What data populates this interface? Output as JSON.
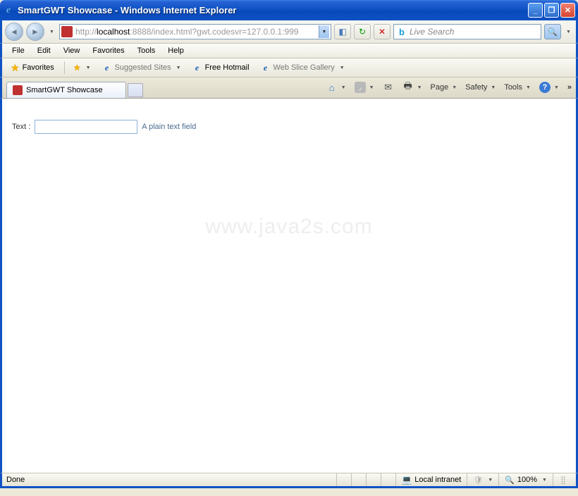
{
  "window": {
    "title": "SmartGWT Showcase - Windows Internet Explorer"
  },
  "nav": {
    "url_prefix": "http://",
    "url_host": "localhost",
    "url_suffix": ":8888/index.html?gwt.codesvr=127.0.0.1:999",
    "search_placeholder": "Live Search"
  },
  "menu": {
    "file": "File",
    "edit": "Edit",
    "view": "View",
    "favorites": "Favorites",
    "tools": "Tools",
    "help": "Help"
  },
  "favbar": {
    "label": "Favorites",
    "suggested": "Suggested Sites",
    "hotmail": "Free Hotmail",
    "webslice": "Web Slice Gallery"
  },
  "tab": {
    "title": "SmartGWT Showcase"
  },
  "cmd": {
    "page": "Page",
    "safety": "Safety",
    "tools": "Tools"
  },
  "form": {
    "label": "Text :",
    "hint": "A plain text field"
  },
  "watermark": "www.java2s.com",
  "status": {
    "done": "Done",
    "zone": "Local intranet",
    "zoom": "100%"
  }
}
